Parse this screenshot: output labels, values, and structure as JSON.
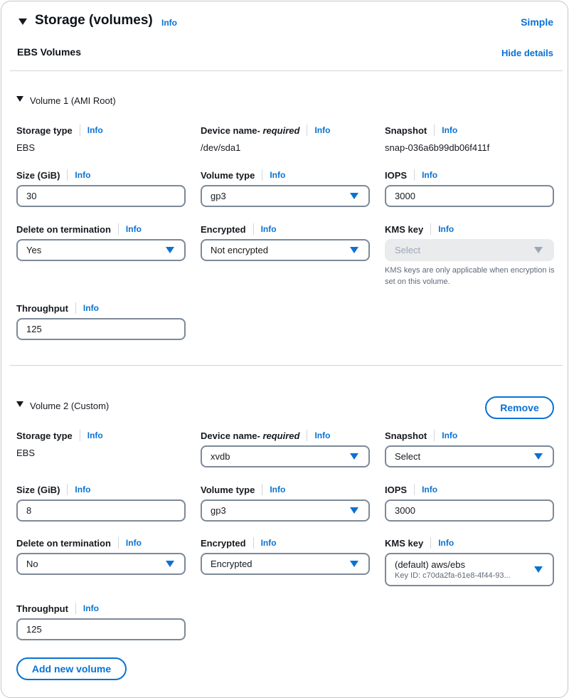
{
  "header": {
    "title": "Storage (volumes)",
    "info": "Info",
    "simple_link": "Simple",
    "subtitle": "EBS Volumes",
    "hide_details": "Hide details"
  },
  "colors": {
    "accent": "#0972d3",
    "text": "#16191f",
    "border": "#7d8998",
    "disabled_bg": "#e9ebed"
  },
  "volumes": [
    {
      "title": "Volume 1 (AMI Root)",
      "storage_type": {
        "label": "Storage type",
        "info": "Info",
        "value": "EBS"
      },
      "device_name": {
        "label": "Device name",
        "required": " - required",
        "info": "Info",
        "value": "/dev/sda1"
      },
      "snapshot": {
        "label": "Snapshot",
        "info": "Info",
        "value": "snap-036a6b99db06f411f"
      },
      "size": {
        "label": "Size (GiB)",
        "info": "Info",
        "value": "30"
      },
      "volume_type": {
        "label": "Volume type",
        "info": "Info",
        "value": "gp3"
      },
      "iops": {
        "label": "IOPS",
        "info": "Info",
        "value": "3000"
      },
      "delete_on_termination": {
        "label": "Delete on termination",
        "info": "Info",
        "value": "Yes"
      },
      "encrypted": {
        "label": "Encrypted",
        "info": "Info",
        "value": "Not encrypted"
      },
      "kms_key": {
        "label": "KMS key",
        "info": "Info",
        "placeholder": "Select",
        "hint": "KMS keys are only applicable when encryption is set on this volume."
      },
      "throughput": {
        "label": "Throughput",
        "info": "Info",
        "value": "125"
      }
    },
    {
      "title": "Volume 2 (Custom)",
      "remove_label": "Remove",
      "storage_type": {
        "label": "Storage type",
        "info": "Info",
        "value": "EBS"
      },
      "device_name": {
        "label": "Device name",
        "required": " - required",
        "info": "Info",
        "value": "xvdb"
      },
      "snapshot": {
        "label": "Snapshot",
        "info": "Info",
        "value": "Select"
      },
      "size": {
        "label": "Size (GiB)",
        "info": "Info",
        "value": "8"
      },
      "volume_type": {
        "label": "Volume type",
        "info": "Info",
        "value": "gp3"
      },
      "iops": {
        "label": "IOPS",
        "info": "Info",
        "value": "3000"
      },
      "delete_on_termination": {
        "label": "Delete on termination",
        "info": "Info",
        "value": "No"
      },
      "encrypted": {
        "label": "Encrypted",
        "info": "Info",
        "value": "Encrypted"
      },
      "kms_key": {
        "label": "KMS key",
        "info": "Info",
        "value": "(default) aws/ebs",
        "key_id": "Key ID: c70da2fa-61e8-4f44-93..."
      },
      "throughput": {
        "label": "Throughput",
        "info": "Info",
        "value": "125"
      }
    }
  ],
  "add_volume_label": "Add new volume"
}
